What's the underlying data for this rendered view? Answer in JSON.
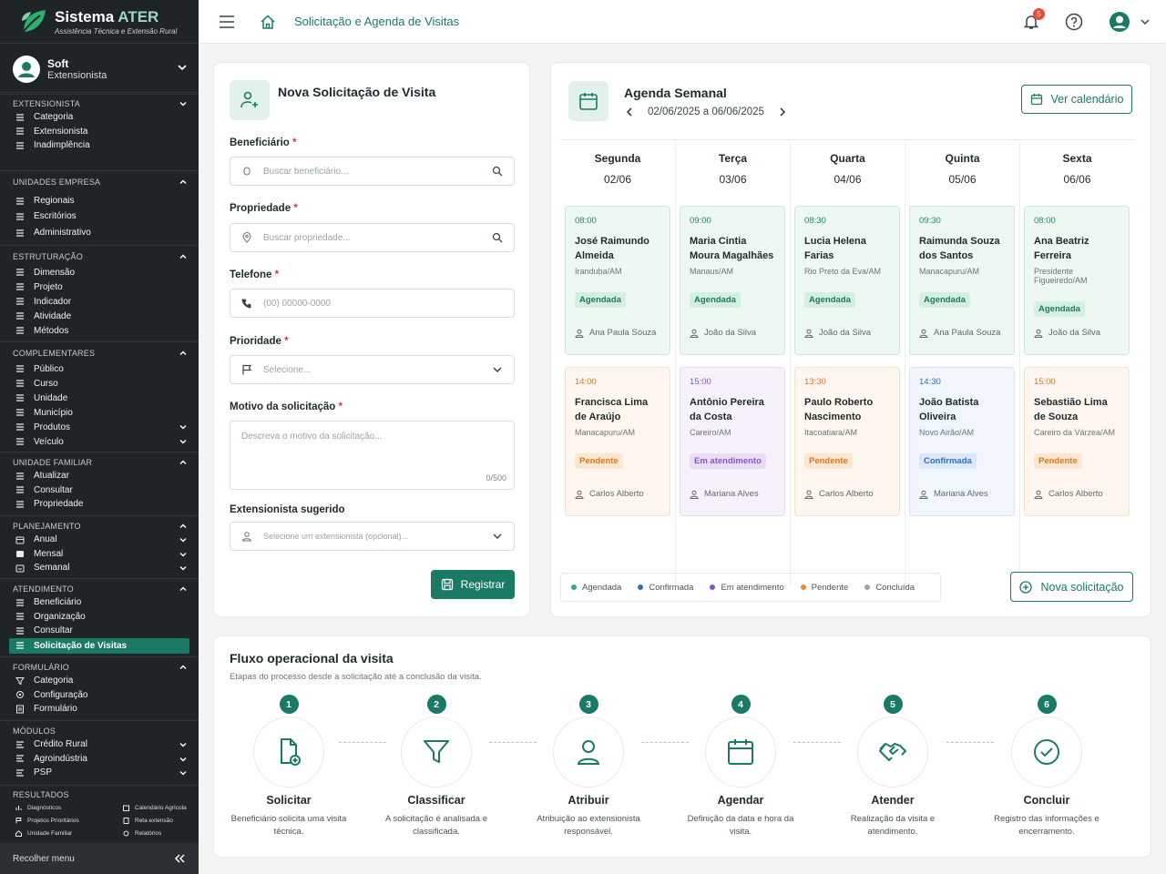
{
  "brand": {
    "title_main": "Sistema",
    "title_accent": "ATER",
    "subtitle": "Assistência Técnica e Extensão Rural"
  },
  "user": {
    "name": "Soft",
    "role": "Extensionista"
  },
  "sidebar": {
    "extensionista": {
      "title": "EXTENSIONISTA",
      "items": [
        "Categoria",
        "Extensionista",
        "Inadimplência"
      ]
    },
    "unidades": {
      "title": "UNIDADES EMPRESA",
      "items": [
        "Regionais",
        "Escritórios",
        "Administrativo"
      ]
    },
    "estruturacao": {
      "title": "ESTRUTURAÇÃO",
      "items": [
        "Dimensão",
        "Projeto",
        "Indicador",
        "Atividade",
        "Métodos"
      ]
    },
    "complementares": {
      "title": "COMPLEMENTARES",
      "items": [
        "Público",
        "Curso",
        "Unidade",
        "Município",
        "Produtos",
        "Veículo"
      ]
    },
    "familiar": {
      "title": "UNIDADE FAMILIAR",
      "items": [
        "Atualizar",
        "Consultar",
        "Propriedade"
      ]
    },
    "planejamento": {
      "title": "PLANEJAMENTO",
      "items": [
        "Anual",
        "Mensal",
        "Semanal"
      ]
    },
    "atendimento": {
      "title": "ATENDIMENTO",
      "items": [
        "Beneficiário",
        "Organização",
        "Consultar",
        "Solicitação de Visitas"
      ]
    },
    "formulario": {
      "title": "FORMULÁRIO",
      "items": [
        "Categoria",
        "Configuração",
        "Formulário"
      ]
    },
    "modulos": {
      "title": "MÓDULOS",
      "items": [
        "Crédito Rural",
        "Agroindústria",
        "PSP"
      ]
    },
    "resultados": {
      "title": "RESULTADOS",
      "items": [
        "Diagnósticos",
        "Calendário Agrícola",
        "Projetos Prioritários",
        "Reta extensão",
        "Unidade Familiar",
        "Relatórios"
      ]
    },
    "collapse_label": "Recolher menu"
  },
  "topbar": {
    "breadcrumb": "Solicitação e Agenda de Visitas",
    "notification_count": "5"
  },
  "form": {
    "title": "Nova Solicitação de Visita",
    "beneficiario": {
      "label": "Beneficiário",
      "placeholder": "Buscar beneficiário..."
    },
    "propriedade": {
      "label": "Propriedade",
      "placeholder": "Buscar propriedade..."
    },
    "telefone": {
      "label": "Telefone",
      "placeholder": "(00) 00000-0000"
    },
    "prioridade": {
      "label": "Prioridade",
      "placeholder": "Selecione..."
    },
    "motivo": {
      "label": "Motivo da solicitação",
      "placeholder": "Descreva o motivo da solicitação...",
      "counter": "0/500"
    },
    "extensionista": {
      "label": "Extensionista sugerido",
      "placeholder": "Selecione um extensionista (opcional)..."
    },
    "required_mark": "*",
    "submit": "Registrar"
  },
  "agenda": {
    "title": "Agenda Semanal",
    "range": "02/06/2025 a 06/06/2025",
    "calendar_button": "Ver calendário",
    "new_button": "Nova solicitação",
    "days": [
      {
        "name": "Segunda",
        "date": "02/06"
      },
      {
        "name": "Terça",
        "date": "03/06"
      },
      {
        "name": "Quarta",
        "date": "04/06"
      },
      {
        "name": "Quinta",
        "date": "05/06"
      },
      {
        "name": "Sexta",
        "date": "06/06"
      }
    ],
    "appointments": [
      {
        "time": "08:00",
        "name": "José Raimundo Almeida",
        "city": "Iranduba/AM",
        "status": "Agendada",
        "staff": "Ana Paula Souza",
        "kind": "agendada"
      },
      {
        "time": "09:00",
        "name": "Maria Cintia Moura Magalhães",
        "city": "Manaus/AM",
        "status": "Agendada",
        "staff": "João da Silva",
        "kind": "agendada"
      },
      {
        "time": "08:30",
        "name": "Lucia Helena Farias",
        "city": "Rio Preto da Eva/AM",
        "status": "Agendada",
        "staff": "João da Silva",
        "kind": "agendada"
      },
      {
        "time": "09:30",
        "name": "Raimunda Souza dos Santos",
        "city": "Manacapuru/AM",
        "status": "Agendada",
        "staff": "Ana Paula Souza",
        "kind": "agendada"
      },
      {
        "time": "08:00",
        "name": "Ana Beatriz Ferreira",
        "city": "Presidente Figueiredo/AM",
        "status": "Agendada",
        "staff": "João da Silva",
        "kind": "agendada"
      },
      {
        "time": "14:00",
        "name": "Francisca Lima de Araújo",
        "city": "Manacapuru/AM",
        "status": "Pendente",
        "staff": "Carlos Alberto",
        "kind": "pendente"
      },
      {
        "time": "15:00",
        "name": "Antônio Pereira da Costa",
        "city": "Careiro/AM",
        "status": "Em atendimento",
        "staff": "Mariana Alves",
        "kind": "atendimento"
      },
      {
        "time": "13:30",
        "name": "Paulo Roberto Nascimento",
        "city": "Itacoatiara/AM",
        "status": "Pendente",
        "staff": "Carlos Alberto",
        "kind": "pendente"
      },
      {
        "time": "14:30",
        "name": "João Batista Oliveira",
        "city": "Novo Airão/AM",
        "status": "Confirmada",
        "staff": "Mariana Alves",
        "kind": "confirmada"
      },
      {
        "time": "15:00",
        "name": "Sebastião Lima de Souza",
        "city": "Careiro da Várzea/AM",
        "status": "Pendente",
        "staff": "Carlos Alberto",
        "kind": "pendente"
      }
    ],
    "legend": [
      {
        "label": "Agendada",
        "color": "#2fae6f"
      },
      {
        "label": "Confirmada",
        "color": "#2f6fbf"
      },
      {
        "label": "Em atendimento",
        "color": "#8b56c2"
      },
      {
        "label": "Pendente",
        "color": "#ee8a2b"
      },
      {
        "label": "Concluída",
        "color": "#9aa4a6"
      }
    ]
  },
  "flow": {
    "title": "Fluxo operacional da visita",
    "subtitle": "Etapas do processo desde a solicitação até a conclusão da visita.",
    "steps": [
      {
        "num": "1",
        "title": "Solicitar",
        "desc": "Beneficiário solicita uma visita técnica.",
        "icon": "file-plus-icon"
      },
      {
        "num": "2",
        "title": "Classificar",
        "desc": "A solicitação é analisada e classificada.",
        "icon": "filter-icon"
      },
      {
        "num": "3",
        "title": "Atribuir",
        "desc": "Atribuição ao extensionista responsável.",
        "icon": "user-icon"
      },
      {
        "num": "4",
        "title": "Agendar",
        "desc": "Definição da data e hora da visita.",
        "icon": "calendar-icon"
      },
      {
        "num": "5",
        "title": "Atender",
        "desc": "Realização da visita e atendimento.",
        "icon": "handshake-icon"
      },
      {
        "num": "6",
        "title": "Concluir",
        "desc": "Registro das informações e encerramento.",
        "icon": "check-circle-icon"
      }
    ]
  },
  "colors": {
    "primary": "#1a7a66",
    "sidebar_bg": "#1f2427",
    "required": "#d63b3b"
  }
}
